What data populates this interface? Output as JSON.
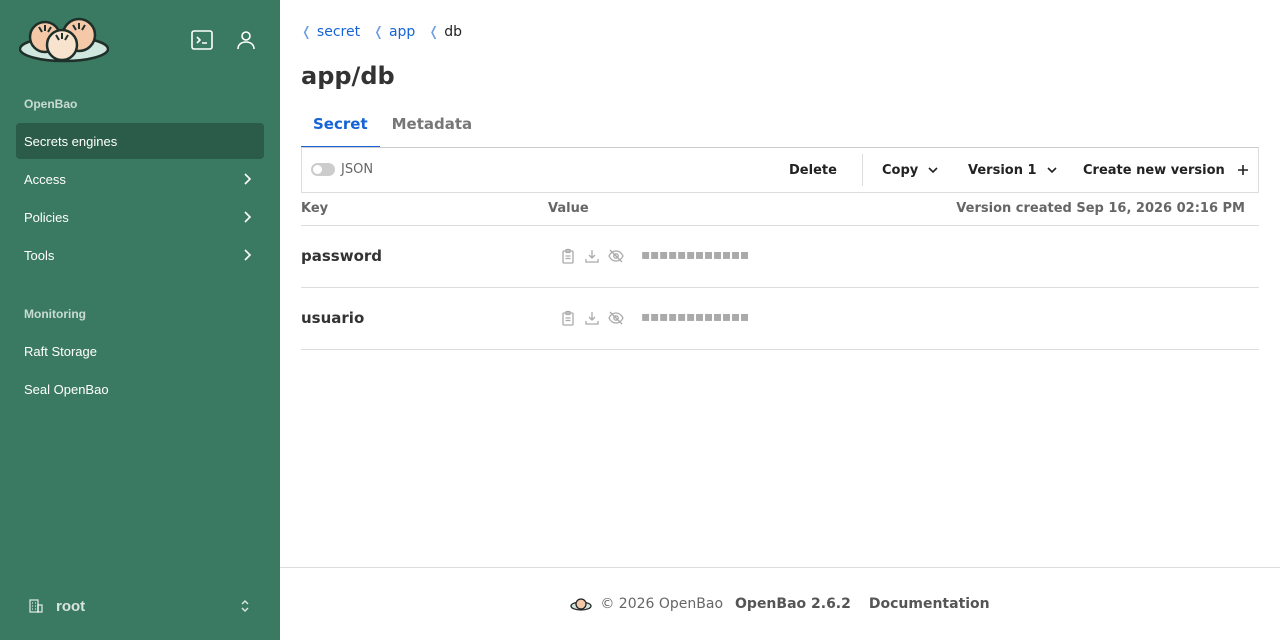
{
  "sidebar": {
    "section_openbao": "OpenBao",
    "section_monitoring": "Monitoring",
    "items": [
      {
        "label": "Secrets engines",
        "active": true
      },
      {
        "label": "Access"
      },
      {
        "label": "Policies"
      },
      {
        "label": "Tools"
      }
    ],
    "monitoring_items": [
      {
        "label": "Raft Storage"
      },
      {
        "label": "Seal OpenBao"
      }
    ],
    "user": "root"
  },
  "breadcrumb": {
    "items": [
      "secret",
      "app"
    ],
    "current": "db"
  },
  "page": {
    "title": "app/db"
  },
  "tabs": [
    {
      "label": "Secret",
      "active": true
    },
    {
      "label": "Metadata"
    }
  ],
  "toolbar": {
    "json_label": "JSON",
    "delete": "Delete",
    "copy": "Copy",
    "version": "Version 1",
    "create": "Create new version"
  },
  "table": {
    "key_header": "Key",
    "value_header": "Value",
    "version_created": "Version created Sep 16, 2026 02:16 PM",
    "rows": [
      {
        "key": "password",
        "masked": "▪▪▪▪▪▪▪▪▪▪▪▪"
      },
      {
        "key": "usuario",
        "masked": "▪▪▪▪▪▪▪▪▪▪▪▪"
      }
    ]
  },
  "footer": {
    "copyright": "© 2026 OpenBao",
    "version": "OpenBao 2.6.2",
    "documentation": "Documentation"
  },
  "colors": {
    "sidebar": "#3b7a62",
    "sidebar_active": "#2a5c49",
    "link": "#1563d6"
  },
  "icons": [
    "openbao-logo",
    "terminal-icon",
    "user-icon",
    "chevron-right-icon",
    "building-icon",
    "chevron-updown-icon",
    "clipboard-icon",
    "download-icon",
    "eye-slash-icon",
    "chevron-down-icon",
    "plus-icon"
  ]
}
